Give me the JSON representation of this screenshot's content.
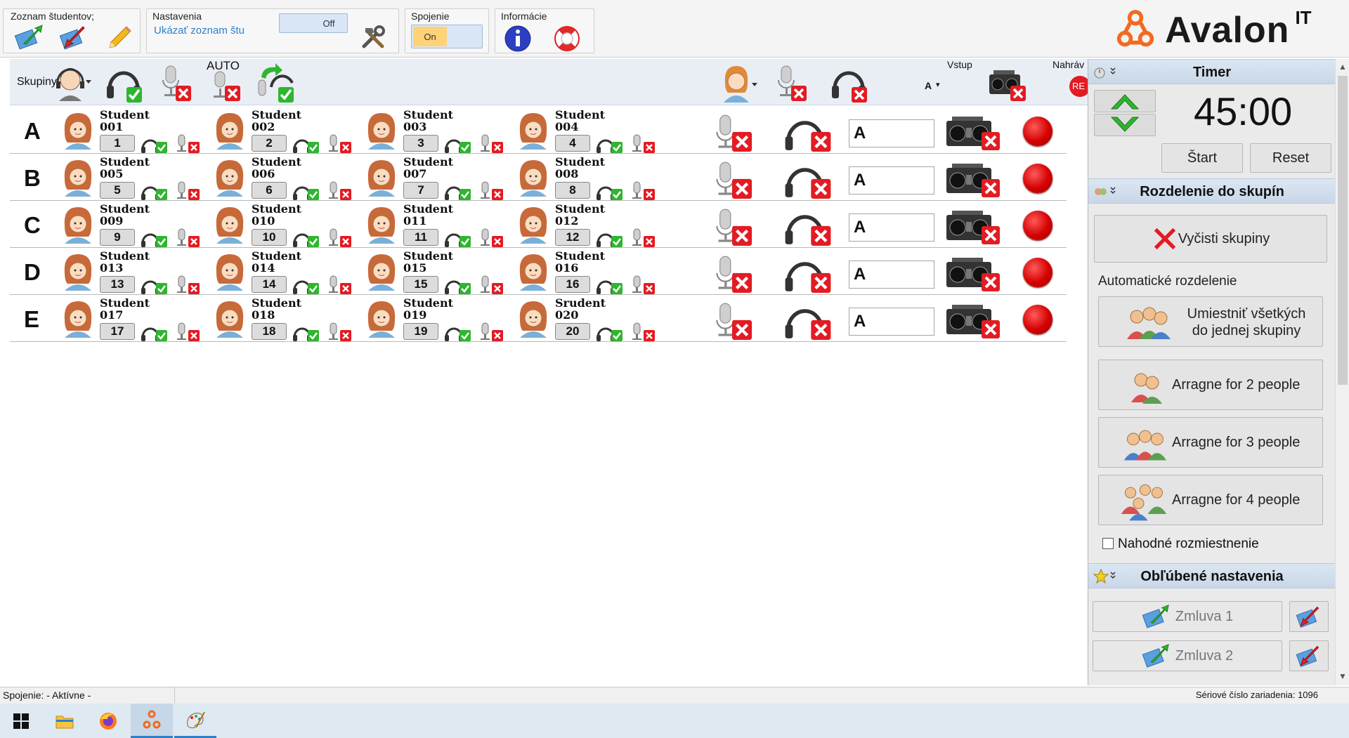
{
  "ribbon": {
    "student_list_title": "Zoznam študentov;",
    "settings_title": "Nastavenia",
    "settings_show_list": "Ukázať zoznam štu",
    "settings_toggle": "Off",
    "connection_title": "Spojenie",
    "connection_toggle": "On",
    "info_title": "Informácie",
    "brand": "Avalon",
    "brand_sup": "IT"
  },
  "toolbar": {
    "groups_label": "Skupiny",
    "auto_label": "AUTO",
    "input_label": "Vstup",
    "input_value": "A",
    "record_label": "Nahráv",
    "rec_text": "RE"
  },
  "groups": [
    {
      "label": "A",
      "input": "A",
      "students": [
        {
          "name": "Student 001",
          "num": "1"
        },
        {
          "name": "Student 002",
          "num": "2"
        },
        {
          "name": "Student 003",
          "num": "3"
        },
        {
          "name": "Student 004",
          "num": "4"
        }
      ]
    },
    {
      "label": "B",
      "input": "A",
      "students": [
        {
          "name": "Student 005",
          "num": "5"
        },
        {
          "name": "Student 006",
          "num": "6"
        },
        {
          "name": "Student 007",
          "num": "7"
        },
        {
          "name": "Student 008",
          "num": "8"
        }
      ]
    },
    {
      "label": "C",
      "input": "A",
      "students": [
        {
          "name": "Student 009",
          "num": "9"
        },
        {
          "name": "Student 010",
          "num": "10"
        },
        {
          "name": "Student 011",
          "num": "11"
        },
        {
          "name": "Student 012",
          "num": "12"
        }
      ]
    },
    {
      "label": "D",
      "input": "A",
      "students": [
        {
          "name": "Student 013",
          "num": "13"
        },
        {
          "name": "Student 014",
          "num": "14"
        },
        {
          "name": "Student 015",
          "num": "15"
        },
        {
          "name": "Student 016",
          "num": "16"
        }
      ]
    },
    {
      "label": "E",
      "input": "A",
      "students": [
        {
          "name": "Student 017",
          "num": "17"
        },
        {
          "name": "Student 018",
          "num": "18"
        },
        {
          "name": "Student 019",
          "num": "19"
        },
        {
          "name": "Srudent 020",
          "num": "20"
        }
      ]
    }
  ],
  "panel": {
    "timer_title": "Timer",
    "timer_value": "45:00",
    "start_label": "Štart",
    "reset_label": "Reset",
    "grouping_title": "Rozdelenie do skupín",
    "clear_groups": "Vyčisti skupiny",
    "auto_split_label": "Automatické rozdelenie",
    "all_in_one_line1": "Umiestniť všetkých",
    "all_in_one_line2": "do jednej skupiny",
    "arrange_2": "Arragne for 2 people",
    "arrange_3": "Arragne for 3 people",
    "arrange_4": "Arragne for 4 people",
    "random_label": "Nahodné rozmiestnenie",
    "favorites_title": "Obľúbené nastavenia",
    "favorites": [
      "Zmluva 1",
      "Zmluva 2"
    ]
  },
  "status": {
    "connection": "Spojenie: - Aktívne -",
    "serial": "Sériové číslo zariadenia: 1096"
  },
  "colors": {
    "accent_blue": "#c8d7e8",
    "record_red": "#d40000",
    "check_green": "#2fb52f",
    "deny_red": "#e31b23",
    "brand_orange": "#f26a21"
  }
}
